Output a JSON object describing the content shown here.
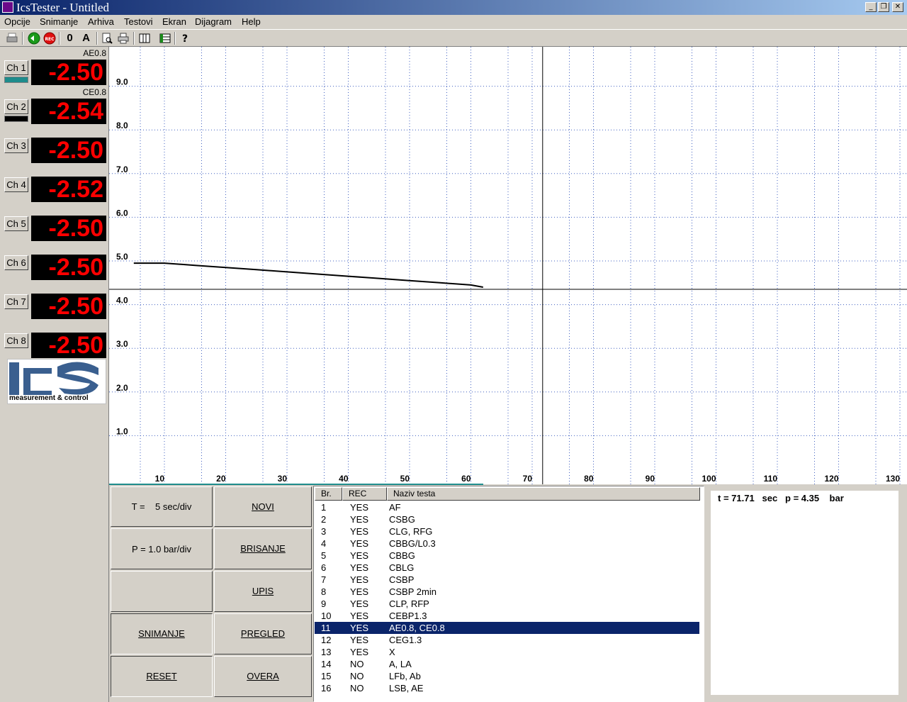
{
  "window": {
    "title": "IcsTester - Untitled"
  },
  "menu": [
    "Opcije",
    "Snimanje",
    "Arhiva",
    "Testovi",
    "Ekran",
    "Dijagram",
    "Help"
  ],
  "toolbar": {
    "zero_label": "0",
    "auto_label": "A",
    "rec_label": "REC"
  },
  "channels": [
    {
      "button": "Ch 1",
      "value": "-2.50",
      "label": "AE0.8",
      "swatch": "#1e8c8c"
    },
    {
      "button": "Ch 2",
      "value": "-2.54",
      "label": "CE0.8",
      "swatch": "#000000"
    },
    {
      "button": "Ch 3",
      "value": "-2.50"
    },
    {
      "button": "Ch 4",
      "value": "-2.52"
    },
    {
      "button": "Ch 5",
      "value": "-2.50"
    },
    {
      "button": "Ch 6",
      "value": "-2.50"
    },
    {
      "button": "Ch 7",
      "value": "-2.50"
    },
    {
      "button": "Ch 8",
      "value": "-2.50"
    }
  ],
  "logo": {
    "text": "measurement & control"
  },
  "chart_data": {
    "type": "line",
    "ylim": [
      0,
      10
    ],
    "xlim": [
      5,
      130
    ],
    "yticks": [
      "1.0",
      "2.0",
      "3.0",
      "4.0",
      "5.0",
      "6.0",
      "7.0",
      "8.0",
      "9.0"
    ],
    "xticks": [
      "10",
      "20",
      "30",
      "40",
      "50",
      "60",
      "70",
      "80",
      "90",
      "100",
      "110",
      "120",
      "130"
    ],
    "grid": true,
    "cursor": {
      "x": 71.71,
      "y": 4.35
    },
    "series": [
      {
        "color": "#000000",
        "x": [
          5,
          10,
          15,
          20,
          25,
          30,
          35,
          40,
          45,
          50,
          55,
          60,
          62
        ],
        "y": [
          4.95,
          4.95,
          4.9,
          4.85,
          4.8,
          4.75,
          4.7,
          4.65,
          4.6,
          4.55,
          4.5,
          4.45,
          4.4
        ]
      }
    ]
  },
  "controls": {
    "time_div": "T =    5 sec/div",
    "pressure_div": "P = 1.0 bar/div",
    "novi": "NOVI",
    "brisanje": "BRISANJE",
    "upis": "UPIS",
    "snimanje": "SNIMANJE",
    "pregled": "PREGLED",
    "reset": "RESET",
    "overa": "OVERA"
  },
  "test_list": {
    "headers": [
      "Br.",
      "REC",
      "Naziv testa"
    ],
    "rows": [
      [
        "1",
        "YES",
        "AF"
      ],
      [
        "2",
        "YES",
        "CSBG"
      ],
      [
        "3",
        "YES",
        "CLG, RFG"
      ],
      [
        "4",
        "YES",
        "CBBG/L0.3"
      ],
      [
        "5",
        "YES",
        "CBBG"
      ],
      [
        "6",
        "YES",
        "CBLG"
      ],
      [
        "7",
        "YES",
        "CSBP"
      ],
      [
        "8",
        "YES",
        "CSBP 2min"
      ],
      [
        "9",
        "YES",
        "CLP, RFP"
      ],
      [
        "10",
        "YES",
        "CEBP1.3"
      ],
      [
        "11",
        "YES",
        "AE0.8, CE0.8"
      ],
      [
        "12",
        "YES",
        "CEG1.3"
      ],
      [
        "13",
        "YES",
        "X"
      ],
      [
        "14",
        "NO",
        "A, LA"
      ],
      [
        "15",
        "NO",
        "LFb, Ab"
      ],
      [
        "16",
        "NO",
        "LSB, AE"
      ]
    ],
    "selected_index": 10
  },
  "readout": {
    "text": "t = 71.71   sec   p = 4.35    bar"
  }
}
